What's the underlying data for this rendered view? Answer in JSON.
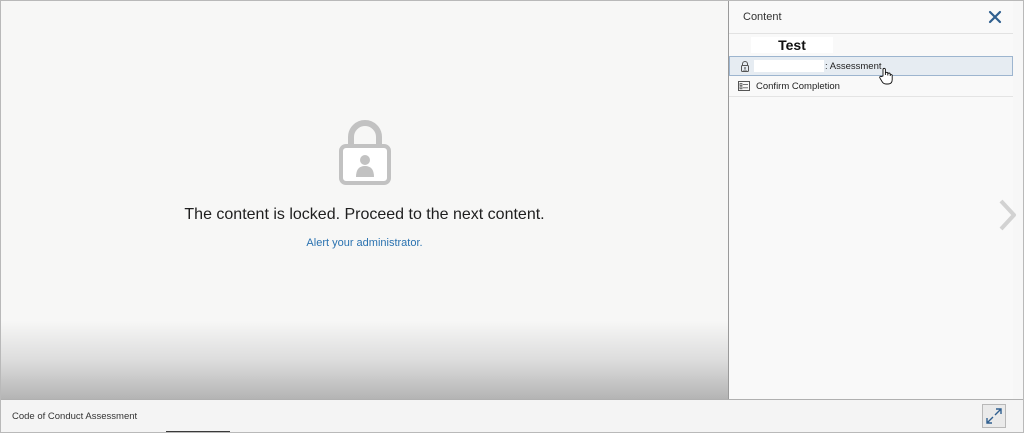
{
  "main": {
    "locked_message": "The content is locked. Proceed to the next content.",
    "alert_link": "Alert your administrator."
  },
  "side_panel": {
    "title": "Content",
    "test_label": "Test",
    "items": [
      {
        "label": ": Assessment",
        "icon": "lock-icon",
        "selected": true
      },
      {
        "label": "Confirm Completion",
        "icon": "checklist-icon",
        "selected": false
      }
    ]
  },
  "footer": {
    "title": "Code of Conduct Assessment"
  },
  "colors": {
    "link": "#2a72b0",
    "selection_bg": "#e6ecf2",
    "selection_border": "#9db5cf",
    "close_icon": "#2f5f8f"
  }
}
